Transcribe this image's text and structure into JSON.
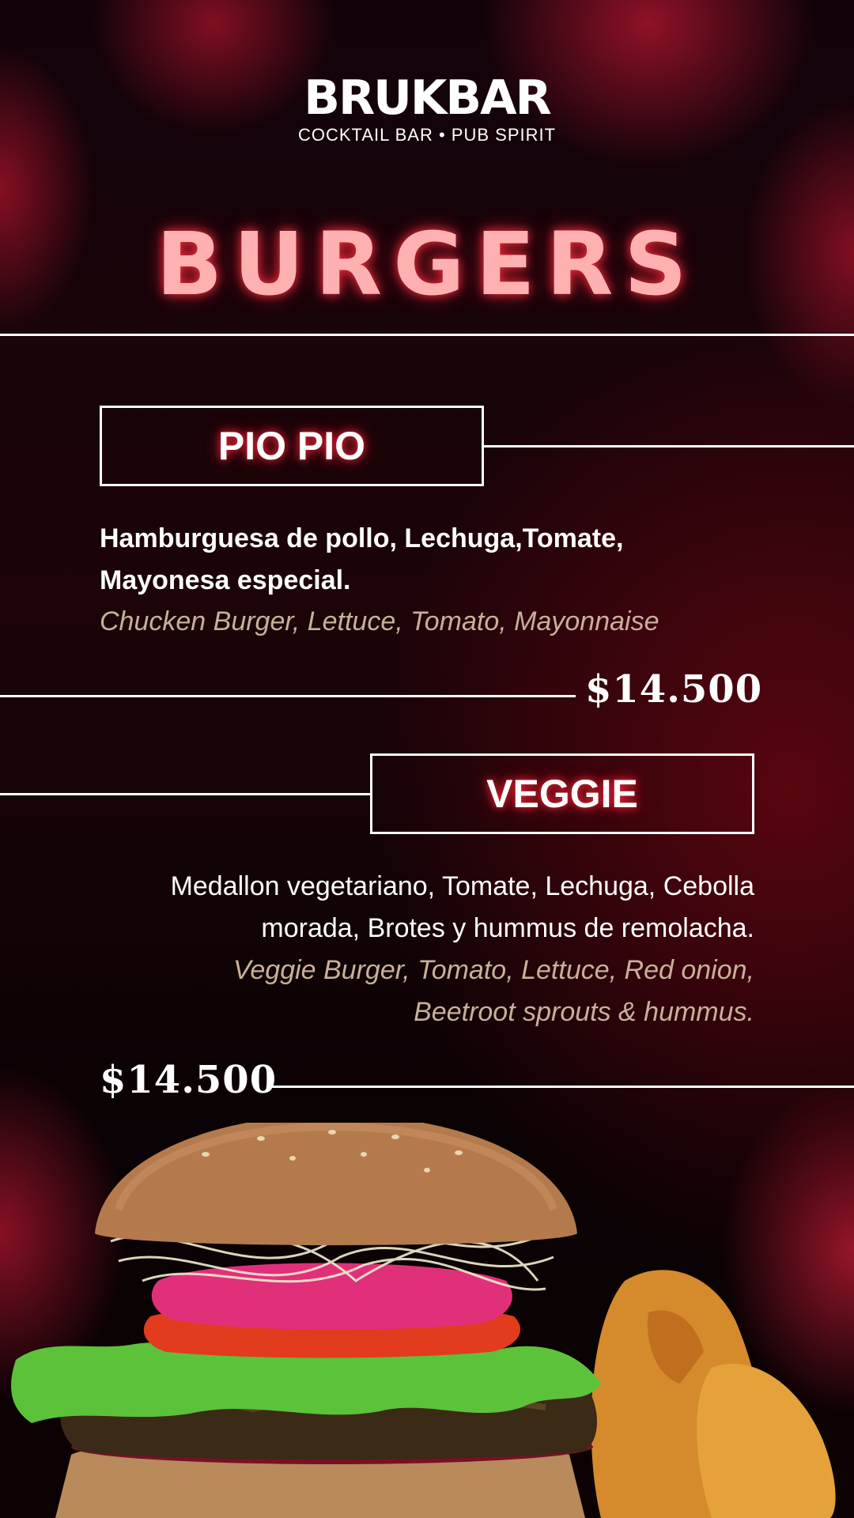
{
  "brand": {
    "name": "BRUKBAR",
    "tagline": "COCKTAIL BAR • PUB SPIRIT"
  },
  "menu": {
    "title": "BURGERS",
    "items": [
      {
        "name": "PIO PIO",
        "description_es": [
          "Hamburguesa de pollo, Lechuga,Tomate,",
          "Mayonesa especial."
        ],
        "description_en": "Chucken Burger, Lettuce, Tomato, Mayonnaise",
        "price": "$14.500"
      },
      {
        "name": "VEGGIE",
        "description_es": [
          "Medallon vegetariano, Tomate, Lechuga, Cebolla",
          "morada, Brotes y hummus de remolacha."
        ],
        "description_en": [
          "Veggie Burger, Tomato, Lettuce, Red onion,",
          "Beetroot sprouts & hummus."
        ],
        "price": "$14.500"
      }
    ]
  },
  "colors": {
    "title_glow": "#ff3046",
    "accent_red": "#8c1024",
    "translation_text": "#c9b09a"
  },
  "images": [
    "veggie-burger-photo",
    "potato-wedges-photo"
  ]
}
